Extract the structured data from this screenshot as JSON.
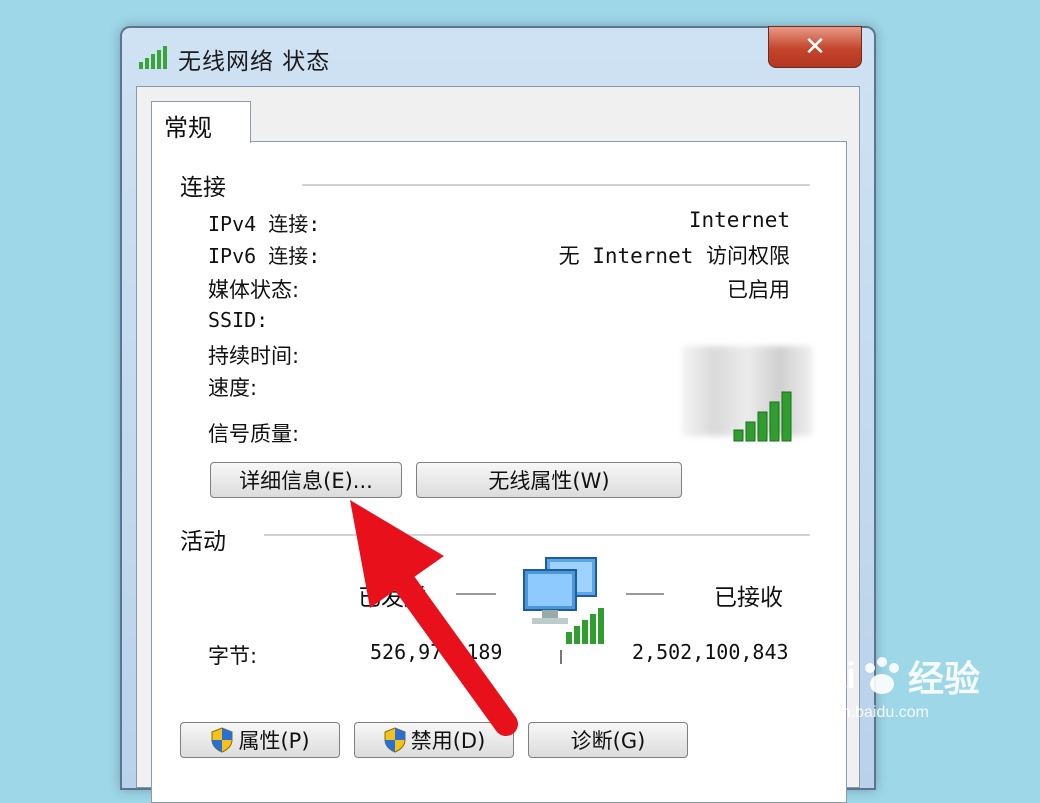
{
  "window": {
    "title": "无线网络 状态",
    "close_label": "✕"
  },
  "tabs": [
    {
      "label": "常规",
      "selected": true
    }
  ],
  "connection": {
    "title": "连接",
    "rows": [
      {
        "label": "IPv4 连接:",
        "value": "Internet"
      },
      {
        "label": "IPv6 连接:",
        "value": "无 Internet 访问权限"
      },
      {
        "label": "媒体状态:",
        "value": "已启用"
      },
      {
        "label": "SSID:",
        "value": ""
      },
      {
        "label": "持续时间:",
        "value": ""
      },
      {
        "label": "速度:",
        "value": ""
      }
    ],
    "signal_label": "信号质量:",
    "signal_bars": 5,
    "details_button": "详细信息(E)...",
    "wireless_props_button": "无线属性(W)"
  },
  "activity": {
    "title": "活动",
    "sent_label": "已发送",
    "received_label": "已接收",
    "bytes_label": "字节:",
    "bytes_sent": "526,973,189",
    "bytes_received": "2,502,100,843"
  },
  "footer_buttons": {
    "properties": "属性(P)",
    "disable": "禁用(D)",
    "diagnose": "诊断(G)"
  },
  "watermark": {
    "brand": "Bai",
    "brand_suffix": "经验",
    "url": "jingyan.baidu.com"
  },
  "colors": {
    "signal_green": "#2f9e2f",
    "arrow_red": "#e8101a",
    "background": "#9ed7e8"
  }
}
